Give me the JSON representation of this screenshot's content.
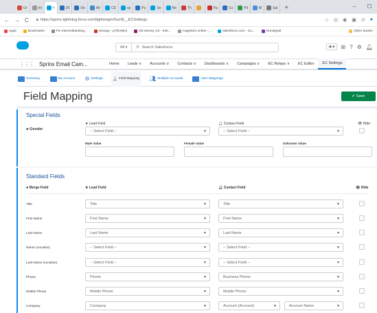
{
  "browser": {
    "tabs": [
      "Or",
      "Inl",
      "",
      "20",
      "De",
      "AV",
      "CE",
      "sp",
      "Pu",
      "Se",
      "Ne",
      "Th",
      "",
      "Pa",
      "Cu",
      "Pil",
      "M",
      "Sal"
    ],
    "new_tab": "+",
    "url": "https://sprinx.lightning.force.com/lightning/n/SxoSt__ECSettings",
    "bookmarks": [
      "Apps",
      "Bookmarks",
      "Fix Internetbanking...",
      "George - pThiAktiv|",
      "GE Money CZ - Inte...",
      "Angstrom online -...",
      "salesforce.com - Cu...",
      "Runsignal"
    ],
    "other_bookmarks": "Other bookm"
  },
  "sf": {
    "search_scope": "All",
    "search_placeholder": "Search Salesforce",
    "app_name": "Sprinx Email Cam...",
    "nav": [
      "Home",
      "Leads",
      "Accounts",
      "Contacts",
      "Dashboards",
      "Campaigns",
      "EC Relays",
      "EC Editor",
      "EC Settings"
    ],
    "nav_arrow": "∨"
  },
  "subtabs": [
    "Summary",
    "My Account",
    "Settings",
    "Field Mapping",
    "Multiple Accounts",
    "User Mappings"
  ],
  "page": {
    "title": "Field Mapping",
    "save_label": "✔ Save"
  },
  "special": {
    "title": "Special Fields",
    "gender_label": "Gender",
    "lead_field_header": "Lead Field",
    "contact_field_header": "Contact Field",
    "hide_header": "Hide",
    "select_placeholder": "-- Select Field --",
    "male_label": "Male Value",
    "female_label": "Female Value",
    "unknown_label": "Unknown Value"
  },
  "standard": {
    "title": "Standard Fields",
    "col_merge": "Merge Field",
    "col_lead": "Lead Field",
    "col_contact": "Contact Field",
    "col_hide": "Hide",
    "rows": [
      {
        "merge": "Title",
        "lead": "Title",
        "contact": "Title"
      },
      {
        "merge": "First Name",
        "lead": "First Name",
        "contact": "First Name"
      },
      {
        "merge": "Last Name",
        "lead": "Last Name",
        "contact": "Last Name"
      },
      {
        "merge": "Name (vocative)",
        "lead": "-- Select Field --",
        "contact": "-- Select Field --"
      },
      {
        "merge": "Last Name (vocative)",
        "lead": "-- Select Field --",
        "contact": "-- Select Field --"
      },
      {
        "merge": "Phone",
        "lead": "Phone",
        "contact": "Business Phone"
      },
      {
        "merge": "Mobile Phone",
        "lead": "Mobile Phone",
        "contact": "Mobile Phone"
      },
      {
        "merge": "Company",
        "lead": "Company",
        "contact": "Account (Account)",
        "contact2": "Account Name"
      }
    ]
  }
}
